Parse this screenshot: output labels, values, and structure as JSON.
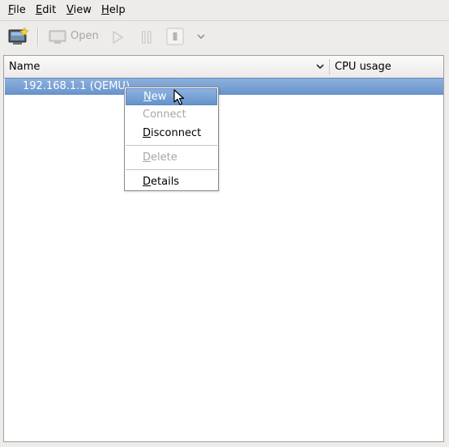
{
  "menubar": {
    "file": {
      "first": "F",
      "rest": "ile"
    },
    "edit": {
      "first": "E",
      "rest": "dit"
    },
    "view": {
      "first": "V",
      "rest": "iew"
    },
    "help": {
      "first": "H",
      "rest": "elp"
    }
  },
  "toolbar": {
    "new_icon": "new-vm-monitor-icon",
    "open_label": "Open",
    "run_icon": "play-icon",
    "pause_icon": "pause-icon",
    "shutdown_icon": "shutdown-icon",
    "shutdown_menu_icon": "chevron-down-icon"
  },
  "list": {
    "columns": [
      "Name",
      "CPU usage"
    ],
    "rows": [
      {
        "name": "192.168.1.1 (QEMU)",
        "selected": true
      }
    ]
  },
  "context_menu": {
    "items": [
      {
        "first": "N",
        "rest": "ew",
        "enabled": true,
        "highlighted": true
      },
      {
        "first": "",
        "rest": "Connect",
        "enabled": false
      },
      {
        "first": "D",
        "rest": "isconnect",
        "enabled": true
      },
      {
        "first": "D",
        "rest": "elete",
        "enabled": false
      },
      {
        "first": "D",
        "rest": "etails",
        "enabled": true
      }
    ]
  },
  "colors": {
    "selection": "#6a95cd",
    "window_bg": "#edeceb",
    "disabled_text": "#a9a6a2"
  }
}
